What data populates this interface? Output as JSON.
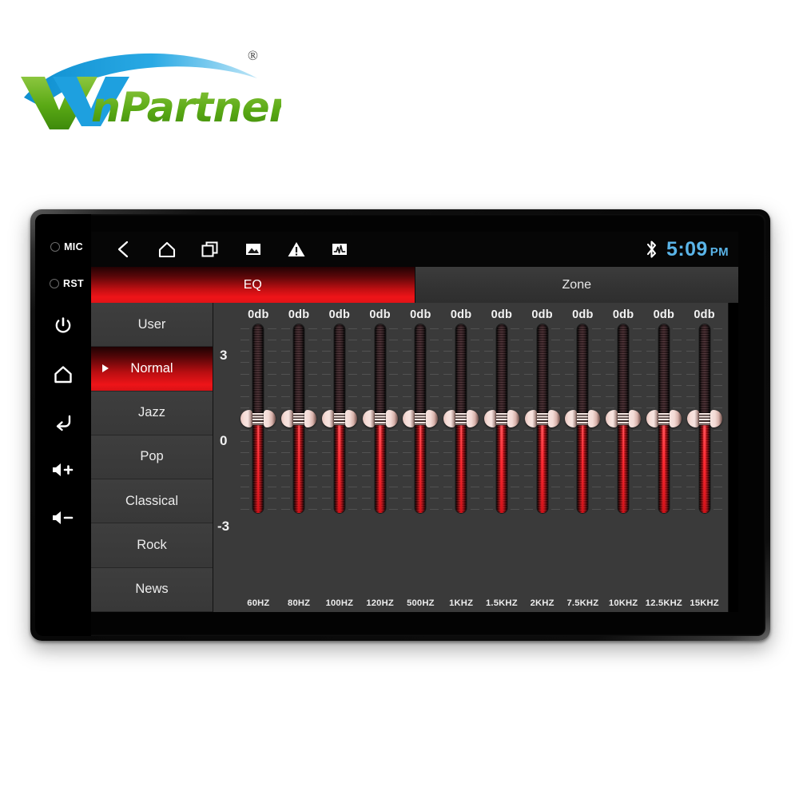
{
  "brand": {
    "name": "WinPartners",
    "registered_mark": "®"
  },
  "device": {
    "hard_keys": [
      {
        "name": "MIC",
        "label": "MIC",
        "icon": "hole-icon"
      },
      {
        "name": "RST",
        "label": "RST",
        "icon": "hole-icon"
      },
      {
        "name": "power",
        "label": "",
        "icon": "power-icon"
      },
      {
        "name": "home",
        "label": "",
        "icon": "home-icon"
      },
      {
        "name": "back",
        "label": "",
        "icon": "back-arrow-icon"
      },
      {
        "name": "volume-up",
        "label": "",
        "icon": "volume-up-icon"
      },
      {
        "name": "volume-down",
        "label": "",
        "icon": "volume-down-icon"
      }
    ]
  },
  "statusbar": {
    "nav_icons": [
      {
        "name": "back-icon",
        "glyph": "chevron-left"
      },
      {
        "name": "home-icon",
        "glyph": "house"
      },
      {
        "name": "recents-icon",
        "glyph": "stacked-squares"
      },
      {
        "name": "gallery-icon",
        "glyph": "photo"
      },
      {
        "name": "warning-icon",
        "glyph": "triangle-exclamation"
      },
      {
        "name": "equalizer-icon",
        "glyph": "waveform-square"
      }
    ],
    "bluetooth_icon": "bluetooth-icon",
    "time": "5:09",
    "ampm": "PM",
    "time_color": "#5ab4e8"
  },
  "tabs": [
    {
      "label": "EQ",
      "active": true
    },
    {
      "label": "Zone",
      "active": false
    }
  ],
  "presets": [
    {
      "label": "User",
      "selected": false
    },
    {
      "label": "Normal",
      "selected": true
    },
    {
      "label": "Jazz",
      "selected": false
    },
    {
      "label": "Pop",
      "selected": false
    },
    {
      "label": "Classical",
      "selected": false
    },
    {
      "label": "Rock",
      "selected": false
    },
    {
      "label": "News",
      "selected": false
    }
  ],
  "equalizer": {
    "scale_labels": {
      "top": "3",
      "middle": "0",
      "bottom": "-3"
    },
    "range_db": [
      -3,
      3
    ],
    "bands": [
      {
        "freq": "60HZ",
        "value": "0db",
        "gain_db": 0
      },
      {
        "freq": "80HZ",
        "value": "0db",
        "gain_db": 0
      },
      {
        "freq": "100HZ",
        "value": "0db",
        "gain_db": 0
      },
      {
        "freq": "120HZ",
        "value": "0db",
        "gain_db": 0
      },
      {
        "freq": "500HZ",
        "value": "0db",
        "gain_db": 0
      },
      {
        "freq": "1KHZ",
        "value": "0db",
        "gain_db": 0
      },
      {
        "freq": "1.5KHZ",
        "value": "0db",
        "gain_db": 0
      },
      {
        "freq": "2KHZ",
        "value": "0db",
        "gain_db": 0
      },
      {
        "freq": "7.5KHZ",
        "value": "0db",
        "gain_db": 0
      },
      {
        "freq": "10KHZ",
        "value": "0db",
        "gain_db": 0
      },
      {
        "freq": "12.5KHZ",
        "value": "0db",
        "gain_db": 0
      },
      {
        "freq": "15KHZ",
        "value": "0db",
        "gain_db": 0
      }
    ]
  },
  "colors": {
    "accent_red": "#ee1418",
    "panel_gray": "#3a3a3a",
    "clock_blue": "#5ab4e8",
    "logo_green": "#6cb518",
    "logo_blue": "#159fdc"
  }
}
